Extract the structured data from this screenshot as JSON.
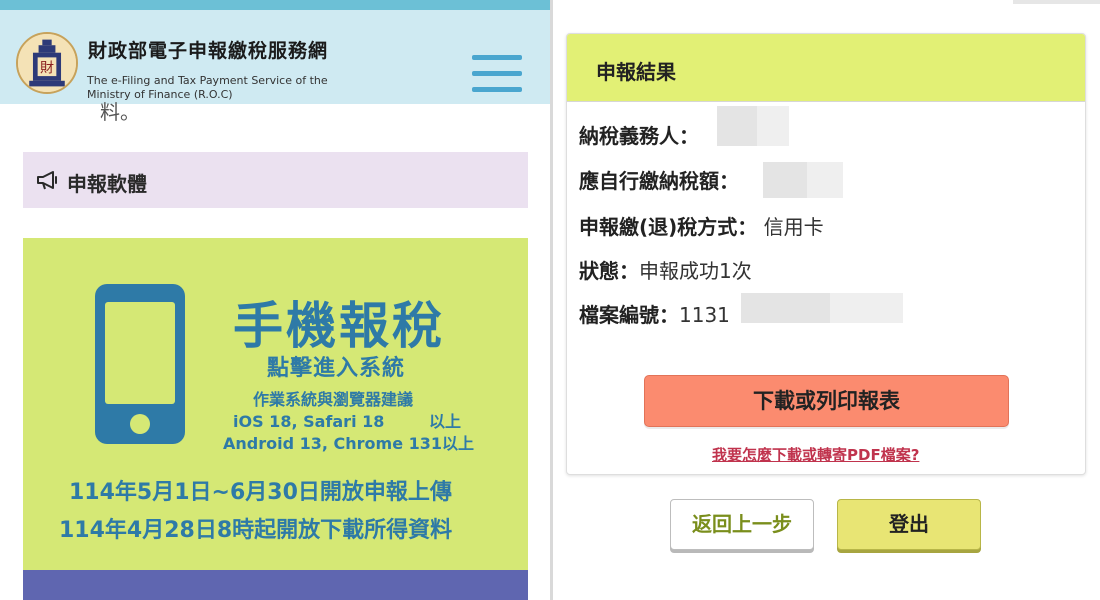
{
  "left": {
    "site_title": "財政部電子申報繳稅服務網",
    "site_subtitle": "The e-Filing and Tax Payment Service of the Ministry of Finance (R.O.C)",
    "truncated_text": "料。",
    "section_label": "申報軟體",
    "banner": {
      "title": "手機報稅",
      "subtitle": "點擊進入系統",
      "os_note": "作業系統與瀏覽器建議",
      "ios": "iOS 18, Safari 18        以上",
      "android": "Android 13, Chrome 131以上",
      "upload_period": "114年5月1日~6月30日開放申報上傳",
      "download_start": "114年4月28日8時起開放下載所得資料"
    },
    "colors": {
      "header_bg": "#cfeaf2",
      "banner_bg": "#d5e875",
      "banner_text": "#2e7aa7"
    }
  },
  "right": {
    "card_title": "申報結果",
    "fields": [
      {
        "label": "納稅義務人：",
        "value": ""
      },
      {
        "label": "應自行繳納稅額：",
        "value": ""
      },
      {
        "label": "申報繳(退)稅方式：",
        "value": " 信用卡"
      },
      {
        "label": "狀態：",
        "value": "申報成功1次"
      },
      {
        "label": "檔案編號：",
        "value": "1131"
      }
    ],
    "download_button": "下載或列印報表",
    "help_link": "我要怎麼下載或轉寄PDF檔案?",
    "back_button": "返回上一步",
    "logout_button": "登出",
    "colors": {
      "card_header_bg": "#e2f075",
      "download_bg": "#fb8b6f",
      "logout_bg": "#e8e574",
      "link": "#c0334d"
    }
  },
  "icons": [
    "emblem-logo",
    "hamburger-menu-icon",
    "megaphone-icon",
    "smartphone-icon"
  ]
}
